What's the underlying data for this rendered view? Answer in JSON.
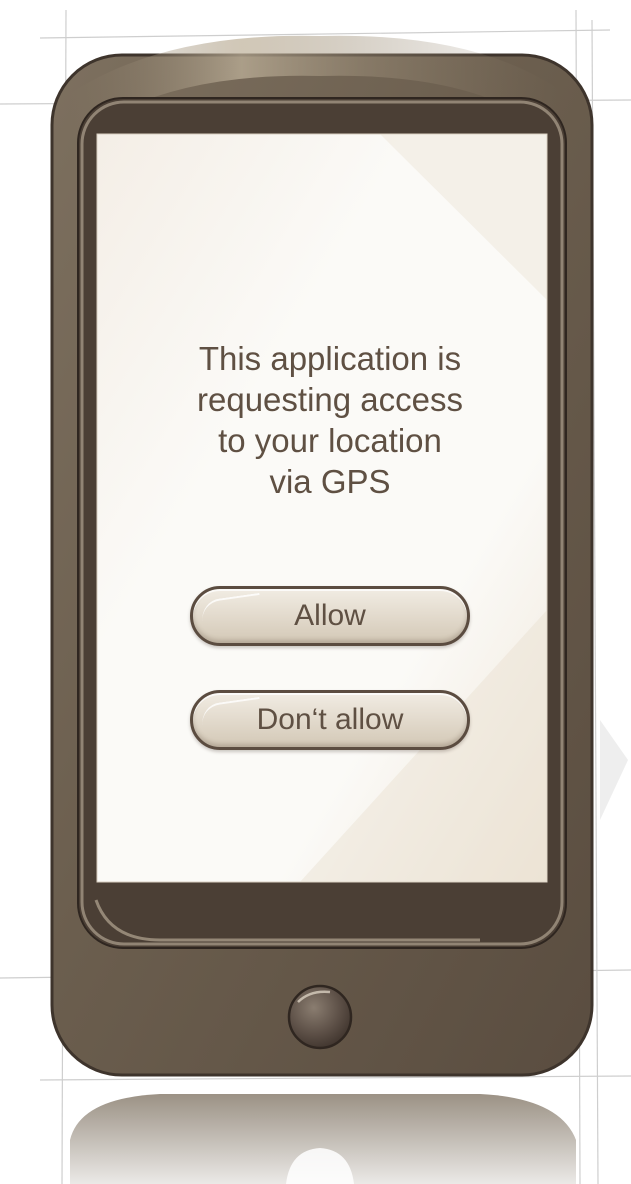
{
  "dialog": {
    "message_lines": [
      "This application is",
      "requesting access",
      "to your location",
      "via GPS"
    ],
    "allow_label": "Allow",
    "deny_label": "Don‘t allow"
  },
  "colors": {
    "device_body": "#6e6150",
    "device_dark": "#4a3d34",
    "screen": "#fbfaf7",
    "text": "#5f5043",
    "button_fill": "#e4dccf",
    "button_border": "#5b4c40"
  },
  "icons": {
    "home_button": "home-button-icon"
  }
}
